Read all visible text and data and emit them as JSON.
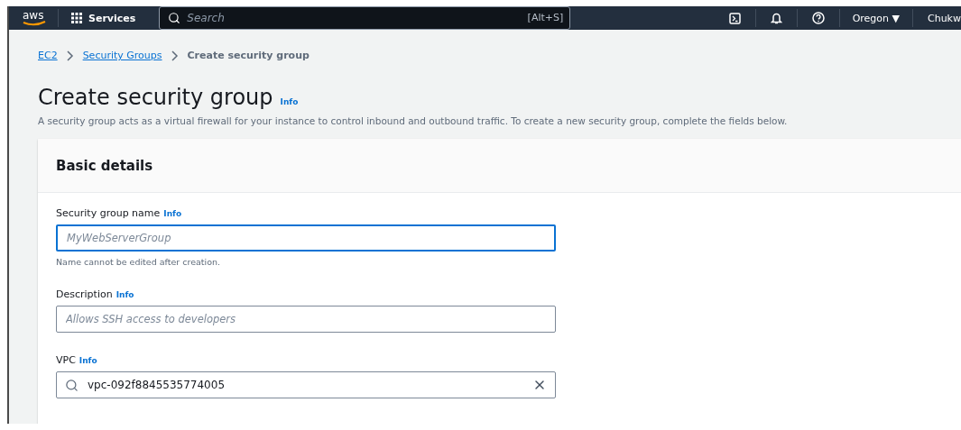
{
  "top_nav": {
    "logo": "aws",
    "services_label": "Services",
    "search": {
      "placeholder": "Search",
      "shortcut": "[Alt+S]"
    },
    "region": "Oregon ▼",
    "account": "Chukw"
  },
  "breadcrumbs": [
    {
      "label": "EC2",
      "kind": "link"
    },
    {
      "label": "Security Groups",
      "kind": "link"
    },
    {
      "label": "Create security group",
      "kind": "current"
    }
  ],
  "page": {
    "title": "Create security group",
    "info": "Info",
    "description": "A security group acts as a virtual firewall for your instance to control inbound and outbound traffic. To create a new security group, complete the fields below."
  },
  "card": {
    "title": "Basic details",
    "fields": [
      {
        "label": "Security group name",
        "info": "Info",
        "kind": "text",
        "placeholder": "MyWebServerGroup",
        "focused": true,
        "hint": "Name cannot be edited after creation."
      },
      {
        "label": "Description",
        "info": "Info",
        "kind": "text",
        "placeholder": "Allows SSH access to developers",
        "focused": false
      },
      {
        "label": "VPC",
        "info": "Info",
        "kind": "search",
        "value": "vpc-092f8845535774005",
        "focused": false
      }
    ]
  }
}
